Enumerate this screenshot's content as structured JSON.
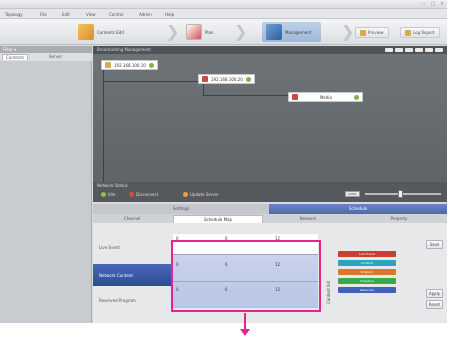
{
  "window": {
    "title": "",
    "controls": [
      "–",
      "□",
      "×"
    ]
  },
  "menu": {
    "items": [
      "Topology",
      "File",
      "Edit",
      "View",
      "Control",
      "Admin",
      "Help"
    ]
  },
  "workflow": {
    "steps": [
      {
        "label": "Contents Edit",
        "icon": "contents-edit-icon"
      },
      {
        "label": "Plan",
        "icon": "plan-icon"
      },
      {
        "label": "Management",
        "icon": "management-icon"
      }
    ],
    "right_tabs": [
      {
        "label": "Preview"
      },
      {
        "label": "Log Report"
      }
    ]
  },
  "left_panel": {
    "header": "Filter ▾",
    "tabs": [
      "Contents",
      "Server"
    ]
  },
  "canvas": {
    "header": "Broadcasting Management",
    "nodes": [
      {
        "label": "192.168.100.10"
      },
      {
        "label": "192.168.100.20"
      },
      {
        "label": "Media"
      }
    ],
    "footer": {
      "status_label": "Network Status",
      "legend": [
        {
          "label": "Idle",
          "color": "#8fc04a"
        },
        {
          "label": "Disconnect",
          "color": "#d64a3a"
        },
        {
          "label": "Update Server",
          "color": "#e6a23c"
        }
      ],
      "zoom": "100%"
    }
  },
  "lower": {
    "headers": [
      "Settings",
      "Schedule"
    ],
    "subtabs": [
      "Channel",
      "Schedule Map",
      "Network",
      "Property"
    ],
    "row_labels": [
      "Live Event",
      "Network Content",
      "Reserved Program"
    ],
    "grid_markers": [
      "0",
      "6",
      "12"
    ],
    "vertical_label": "Content list",
    "legend_bars": [
      {
        "label": "Live Event",
        "color": "#c8402f"
      },
      {
        "label": "Content",
        "color": "#2aa3c4"
      },
      {
        "label": "Program",
        "color": "#d9792a"
      },
      {
        "label": "Schedule",
        "color": "#39a94b"
      },
      {
        "label": "Reserved",
        "color": "#3e63b8"
      }
    ],
    "buttons": [
      "Save",
      "Apply",
      "Reset"
    ]
  }
}
